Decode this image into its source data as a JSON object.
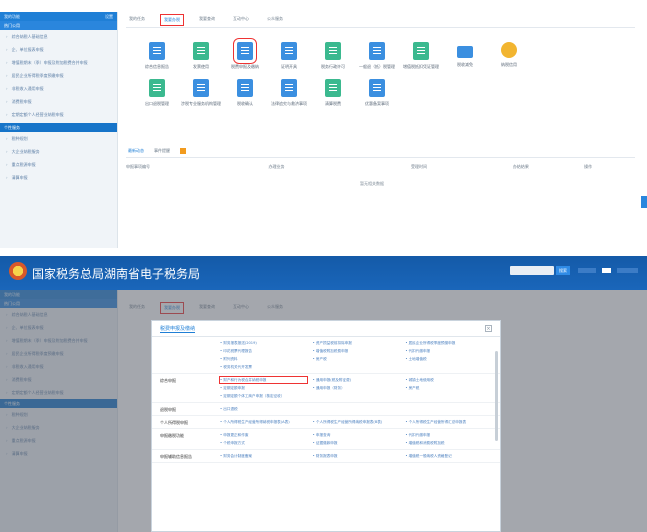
{
  "top": {
    "sidebar": {
      "header": "我的功能",
      "header_badge": "设置",
      "section1": "热门公用",
      "items1": [
        "综合纳税人基础信息",
        "企、单位报表申报",
        "增值税期末（季）申报及附加税费合并申报",
        "居民企业所得税季度预缴申报",
        "非税收入通用申报",
        "消费税申报",
        "定期定额个人经营业纳税申报"
      ],
      "section2": "个性服务",
      "items2": [
        "税种规划",
        "大企业纳税服务",
        "重点税源申报",
        "清算申报"
      ]
    },
    "tabs": [
      "我的任务",
      "我要办税",
      "我要查询",
      "互动中心",
      "公众服务"
    ],
    "active_tab": 1,
    "icons_row1": [
      "综合信息报告",
      "发票使用",
      "税费申报及缴纳",
      "证明开具",
      "税务行政许可",
      "一般退（抵）税管理",
      "增值税抵扣凭证管理",
      "税收减免",
      "纳税信用"
    ],
    "icons_row2": [
      "出口退税管理",
      "涉税专业服务机构管理",
      "税收确认",
      "法律追究与救济事项",
      "清算税费",
      "优惠备案事项"
    ],
    "list_tabs": [
      "最新动态",
      "事件提醒"
    ],
    "table_headers": [
      "申报事项编号",
      "办理业务",
      "受理时间",
      "办结结果",
      "操作"
    ],
    "empty_text": "暂无相关数据"
  },
  "bottom": {
    "site_title": "国家税务总局湖南省电子税务局",
    "search_btn": "搜索",
    "modal_title": "税费申报及缴纳",
    "modal_rows": [
      {
        "category": "",
        "links": [
          "财务报表报送(2019)",
          "资产损益税前扣除申报",
          "居民企业所得税季度预缴申报",
          "印花税票代理报告",
          "增值税附加税费申报",
          "代扣代缴申报",
          "附列资料",
          "房产税",
          "土地增值税",
          "税务机关代开发票"
        ]
      },
      {
        "category": "综合申报",
        "links": [
          "财产和行为税合并纳税申报",
          "通用申报(税及附征费)",
          "城镇土地使用税",
          "定期定额申报",
          "通用申报（财务）",
          "房产税",
          "定期定额个体工商户申报（核定征收）"
        ]
      },
      {
        "category": "退税申报",
        "links": [
          "出口退税"
        ]
      },
      {
        "category": "个人所得税申报",
        "links": [
          "个人所得税生产经营所得纳税申报表(A表)",
          "个人所得税生产经营所得纳税申报表(B表)",
          "个人所得税生产经营所得汇总申报表"
        ]
      },
      {
        "category": "申报缴税功能",
        "links": [
          "申报更正和作废",
          "申报查询",
          "代扣代缴申报",
          "个税申报方式",
          "证据缴款申报",
          "增值税和消费税附加税"
        ]
      },
      {
        "category": "申报辅助信息报告",
        "links": [
          "财务会计制度备案",
          "财务报表申报",
          "增值税一般纳税人资格登记"
        ]
      }
    ]
  },
  "colors": {
    "brand": "#1f7fd6",
    "highlight": "#e33333",
    "banner": "#145aa8"
  }
}
